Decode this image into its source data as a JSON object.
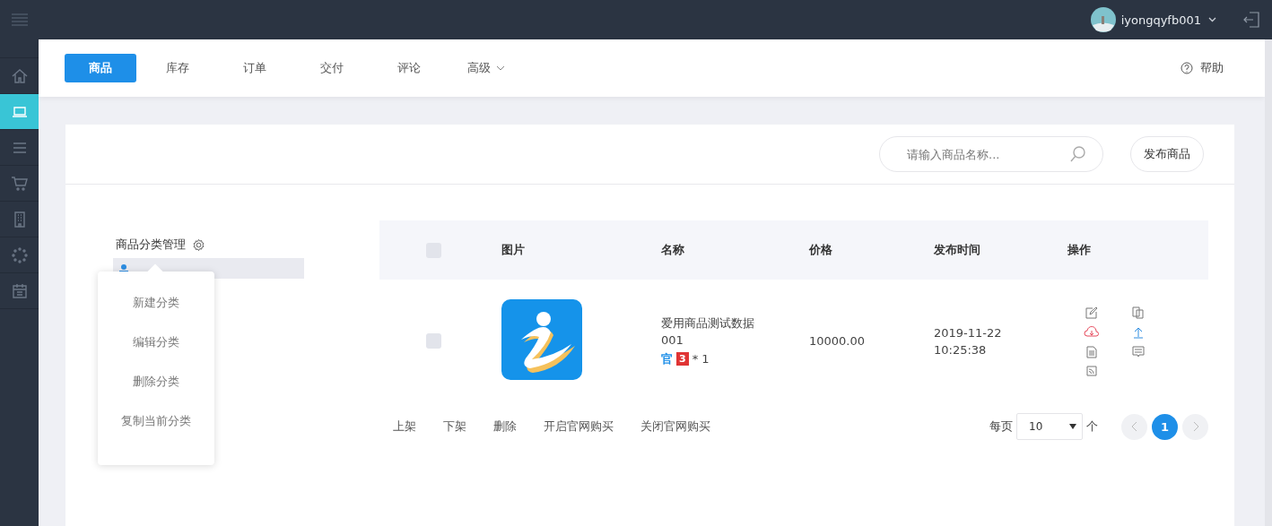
{
  "user": {
    "name": "iyongqyfb001"
  },
  "sidebar": {
    "items": [
      {
        "kind": "home",
        "selected": false
      },
      {
        "kind": "laptop",
        "selected": true
      },
      {
        "kind": "list",
        "selected": false
      },
      {
        "kind": "cart",
        "selected": false
      },
      {
        "kind": "building",
        "selected": false
      },
      {
        "kind": "spinner",
        "selected": false
      },
      {
        "kind": "calendar",
        "selected": false
      }
    ]
  },
  "tabs": [
    {
      "label": "商品",
      "selected": true,
      "dropdown": false
    },
    {
      "label": "库存",
      "selected": false,
      "dropdown": false
    },
    {
      "label": "订单",
      "selected": false,
      "dropdown": false
    },
    {
      "label": "交付",
      "selected": false,
      "dropdown": false
    },
    {
      "label": "评论",
      "selected": false,
      "dropdown": false
    },
    {
      "label": "高级",
      "selected": false,
      "dropdown": true
    }
  ],
  "help": "帮助",
  "search": {
    "placeholder": "请输入商品名称..."
  },
  "publish_button": "发布商品",
  "category": {
    "title": "商品分类管理",
    "menu": [
      "新建分类",
      "编辑分类",
      "删除分类",
      "复制当前分类"
    ]
  },
  "table": {
    "select_all_checked": false,
    "columns": [
      "图片",
      "名称",
      "价格",
      "发布时间",
      "操作"
    ],
    "rows": [
      {
        "checked": false,
        "name": "爱用商品测试数据001",
        "tag": "官",
        "badge": "3",
        "count": "* 1",
        "price": "10000.00",
        "time": "2019-11-22 10:25:38"
      }
    ]
  },
  "bulk_actions": [
    "上架",
    "下架",
    "删除",
    "开启官网购买",
    "关闭官网购买"
  ],
  "pagination": {
    "per_page_label": "每页",
    "per_page": "10",
    "unit": "个",
    "pages": [
      {
        "label": "1",
        "selected": true
      }
    ]
  }
}
